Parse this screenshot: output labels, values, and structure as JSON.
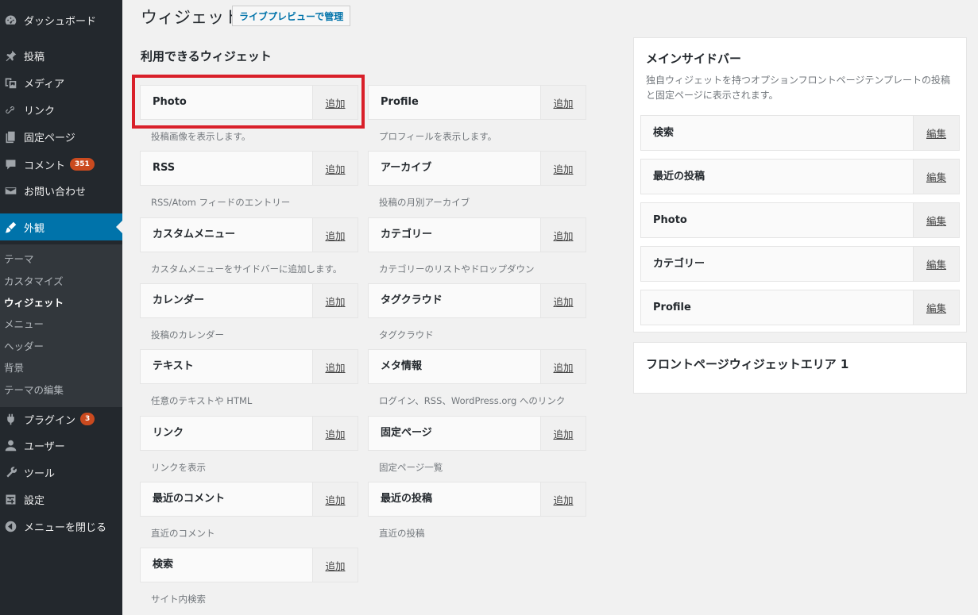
{
  "sidebar": {
    "items": [
      {
        "label": "ダッシュボード",
        "icon": "dashboard-icon"
      },
      {
        "label": "投稿",
        "icon": "pin-icon"
      },
      {
        "label": "メディア",
        "icon": "media-icon"
      },
      {
        "label": "リンク",
        "icon": "link-icon"
      },
      {
        "label": "固定ページ",
        "icon": "page-icon"
      },
      {
        "label": "コメント",
        "icon": "comment-icon",
        "badge": "351"
      },
      {
        "label": "お問い合わせ",
        "icon": "mail-icon"
      },
      {
        "label": "外観",
        "icon": "brush-icon"
      },
      {
        "label": "プラグイン",
        "icon": "plugin-icon",
        "badge": "3"
      },
      {
        "label": "ユーザー",
        "icon": "user-icon"
      },
      {
        "label": "ツール",
        "icon": "wrench-icon"
      },
      {
        "label": "設定",
        "icon": "settings-icon"
      },
      {
        "label": "メニューを閉じる",
        "icon": "collapse-icon"
      }
    ],
    "submenu": [
      "テーマ",
      "カスタマイズ",
      "ウィジェット",
      "メニュー",
      "ヘッダー",
      "背景",
      "テーマの編集"
    ]
  },
  "header": {
    "title": "ウィジェット",
    "live_button": "ライブプレビューで管理"
  },
  "available": {
    "heading": "利用できるウィジェット",
    "add_label": "追加",
    "widgets": [
      {
        "name": "Photo",
        "desc": "投稿画像を表示します。"
      },
      {
        "name": "Profile",
        "desc": "プロフィールを表示します。"
      },
      {
        "name": "RSS",
        "desc": "RSS/Atom フィードのエントリー"
      },
      {
        "name": "アーカイブ",
        "desc": "投稿の月別アーカイブ"
      },
      {
        "name": "カスタムメニュー",
        "desc": "カスタムメニューをサイドバーに追加します。"
      },
      {
        "name": "カテゴリー",
        "desc": "カテゴリーのリストやドロップダウン"
      },
      {
        "name": "カレンダー",
        "desc": "投稿のカレンダー"
      },
      {
        "name": "タグクラウド",
        "desc": "タグクラウド"
      },
      {
        "name": "テキスト",
        "desc": "任意のテキストや HTML"
      },
      {
        "name": "メタ情報",
        "desc": "ログイン、RSS、WordPress.org へのリンク"
      },
      {
        "name": "リンク",
        "desc": "リンクを表示"
      },
      {
        "name": "固定ページ",
        "desc": "固定ページ一覧"
      },
      {
        "name": "最近のコメント",
        "desc": "直近のコメント"
      },
      {
        "name": "最近の投稿",
        "desc": "直近の投稿"
      },
      {
        "name": "検索",
        "desc": "サイト内検索"
      }
    ]
  },
  "main_sidebar": {
    "title": "メインサイドバー",
    "description": "独自ウィジェットを持つオプションフロントページテンプレートの投稿と固定ページに表示されます。",
    "edit_label": "編集",
    "widgets": [
      "検索",
      "最近の投稿",
      "Photo",
      "カテゴリー",
      "Profile"
    ]
  },
  "front_area": {
    "title": "フロントページウィジェットエリア 1"
  }
}
